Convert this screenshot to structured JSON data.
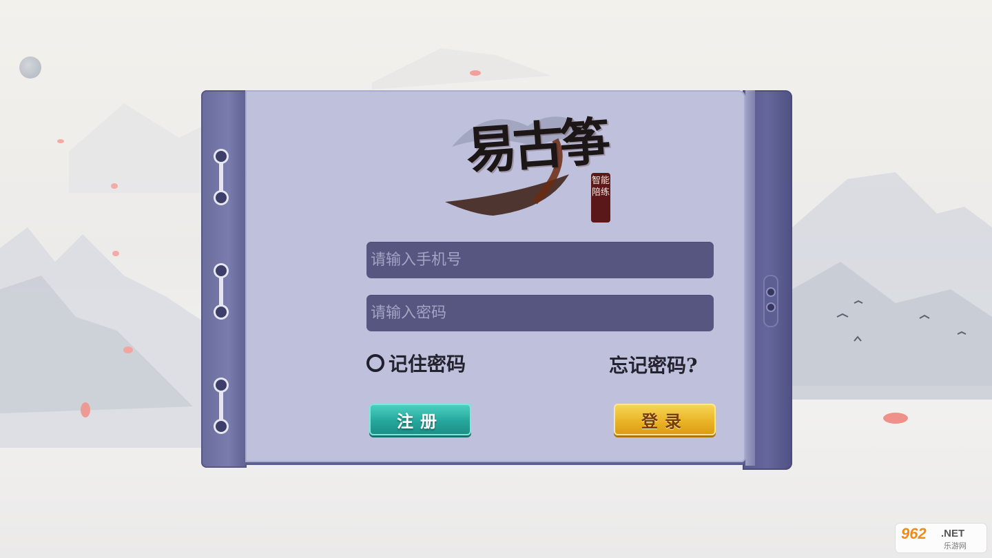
{
  "logo": {
    "title": "易古筝",
    "seal": "智能陪练"
  },
  "form": {
    "phone_placeholder": "请输入手机号",
    "password_placeholder": "请输入密码",
    "remember_label": "记住密码",
    "forgot_label": "忘记密码?",
    "register_label": "注册",
    "login_label": "登录"
  },
  "watermark": {
    "brand": "962",
    "domain": ".NET",
    "subtitle": "乐游网"
  },
  "colors": {
    "page": "#bfc0dc",
    "field": "#565681",
    "register": "#26a79c",
    "login": "#eab428"
  }
}
